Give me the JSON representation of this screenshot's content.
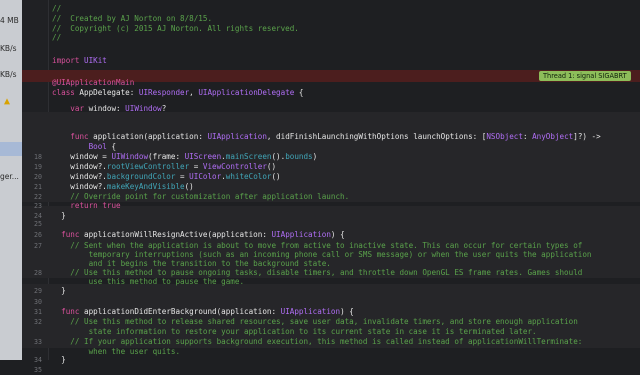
{
  "sidebar": {
    "labels": [
      "4 MB",
      "KB/s",
      "KB/s",
      "",
      "ger...",
      ""
    ]
  },
  "editor": {
    "error_badge": "Thread 1: signal SIGABRT",
    "lines": [
      {
        "n": "",
        "t": "//"
      },
      {
        "n": "",
        "t": "//  Created by AJ Norton on 8/8/15."
      },
      {
        "n": "",
        "t": "//  Copyright (c) 2015 AJ Norton. All rights reserved."
      },
      {
        "n": "",
        "t": "//"
      },
      {
        "n": "",
        "t": ""
      },
      {
        "n": "",
        "t": "import UIKit"
      },
      {
        "n": "",
        "t": ""
      },
      {
        "n": "",
        "t": "@UIApplicationMain"
      },
      {
        "n": "",
        "t": "class AppDelegate: UIResponder, UIApplicationDelegate {"
      },
      {
        "n": "",
        "t": ""
      },
      {
        "n": "",
        "t": "    var window: UIWindow?"
      },
      {
        "n": "",
        "t": ""
      },
      {
        "n": "",
        "t": ""
      },
      {
        "n": "",
        "t": "    func application(application: UIApplication, didFinishLaunchingWithOptions launchOptions: [NSObject: AnyObject]?) ->"
      },
      {
        "n": "",
        "t": "        Bool {"
      },
      {
        "n": "18",
        "t": "    window = UIWindow(frame: UIScreen.mainScreen().bounds)"
      },
      {
        "n": "19",
        "t": "    window?.rootViewController = ViewController()"
      },
      {
        "n": "20",
        "t": "    window?.backgroundColor = UIColor.whiteColor()"
      },
      {
        "n": "21",
        "t": "    window?.makeKeyAndVisible()"
      },
      {
        "n": "22",
        "t": "    // Override point for customization after application launch."
      },
      {
        "n": "23",
        "t": "    return true"
      },
      {
        "n": "24",
        "t": "  }"
      },
      {
        "n": "25",
        "t": ""
      },
      {
        "n": "26",
        "t": "  func applicationWillResignActive(application: UIApplication) {"
      },
      {
        "n": "27",
        "t": "    // Sent when the application is about to move from active to inactive state. This can occur for certain types of"
      },
      {
        "n": "",
        "t": "        temporary interruptions (such as an incoming phone call or SMS message) or when the user quits the application"
      },
      {
        "n": "",
        "t": "        and it begins the transition to the background state."
      },
      {
        "n": "28",
        "t": "    // Use this method to pause ongoing tasks, disable timers, and throttle down OpenGL ES frame rates. Games should"
      },
      {
        "n": "",
        "t": "        use this method to pause the game."
      },
      {
        "n": "29",
        "t": "  }"
      },
      {
        "n": "30",
        "t": ""
      },
      {
        "n": "31",
        "t": "  func applicationDidEnterBackground(application: UIApplication) {"
      },
      {
        "n": "32",
        "t": "    // Use this method to release shared resources, save user data, invalidate timers, and store enough application"
      },
      {
        "n": "",
        "t": "        state information to restore your application to its current state in case it is terminated later."
      },
      {
        "n": "33",
        "t": "    // If your application supports background execution, this method is called instead of applicationWillTerminate:"
      },
      {
        "n": "",
        "t": "        when the user quits."
      },
      {
        "n": "34",
        "t": "  }"
      },
      {
        "n": "35",
        "t": ""
      }
    ]
  },
  "colors": {
    "keyword": "#d8519b",
    "comment": "#5aa24b",
    "type": "#b06ef5",
    "error_band": "#4c1e1e",
    "badge": "#8dbd5a"
  }
}
